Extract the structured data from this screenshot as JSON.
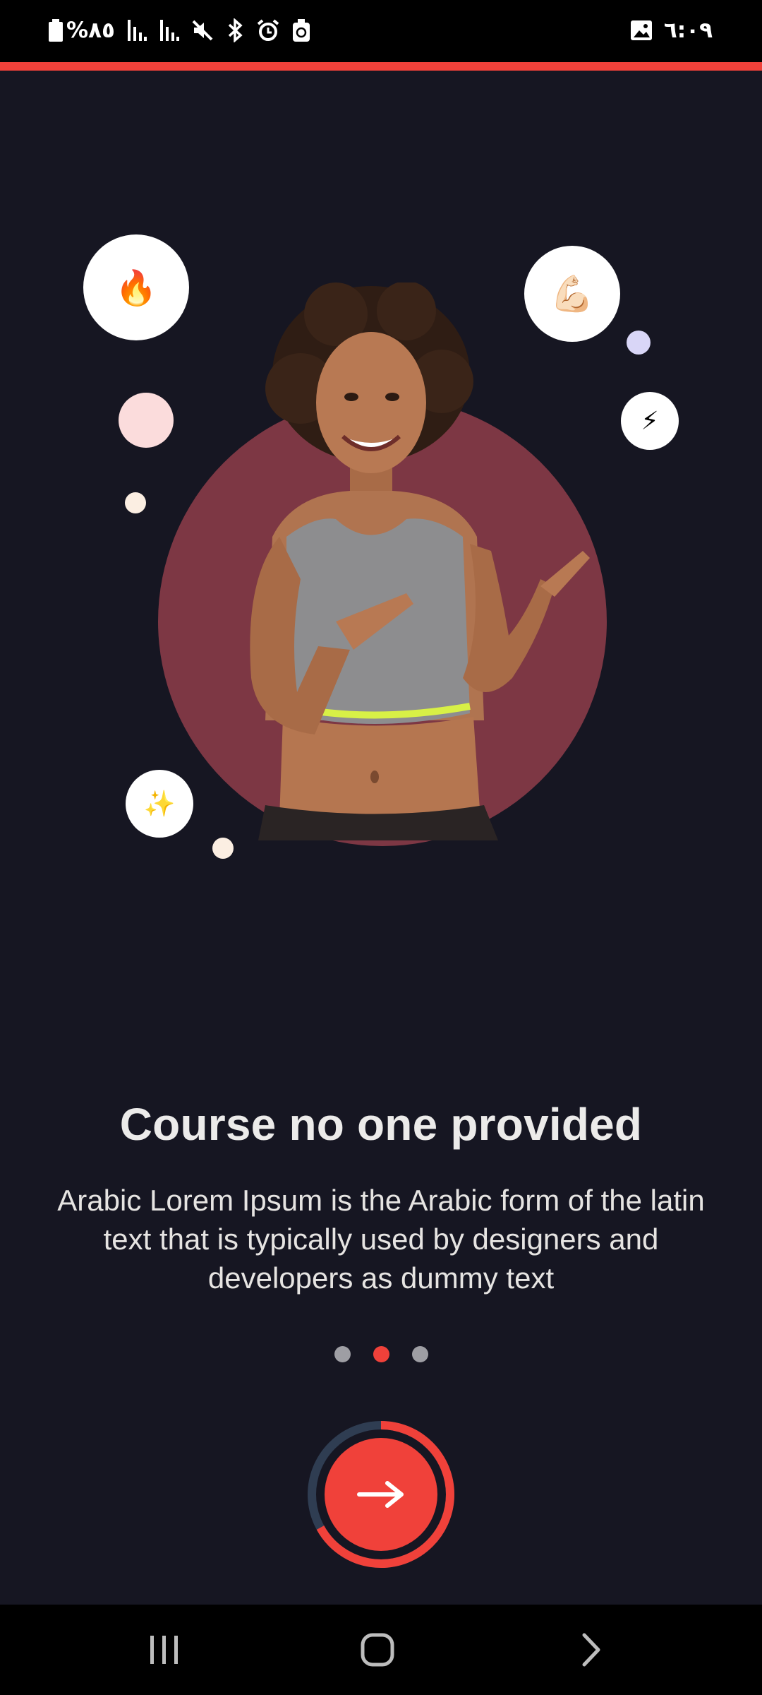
{
  "status_bar": {
    "battery_text": "%٨٥",
    "time": "٦:٠٩",
    "icons": [
      "battery-icon",
      "signal-icon",
      "signal-icon",
      "mute-icon",
      "bluetooth-icon",
      "alarm-icon",
      "recycle-icon",
      "image-notification-icon"
    ]
  },
  "onboarding": {
    "title": "Course no one provided",
    "description": "Arabic Lorem Ipsum is the Arabic form of the latin text that is typically used by designers and developers as dummy text",
    "page_count": 3,
    "active_page": 2,
    "progress_fraction": 0.67,
    "floating_emojis": [
      "🔥",
      "💪🏻",
      "⚡",
      "✨"
    ]
  },
  "colors": {
    "accent": "#f0413a",
    "background": "#161622",
    "hero_circle": "#7d3744",
    "ring_track": "#2f3d52"
  },
  "nav_bar": {
    "icons": [
      "recent-apps-icon",
      "home-icon",
      "back-icon"
    ]
  }
}
